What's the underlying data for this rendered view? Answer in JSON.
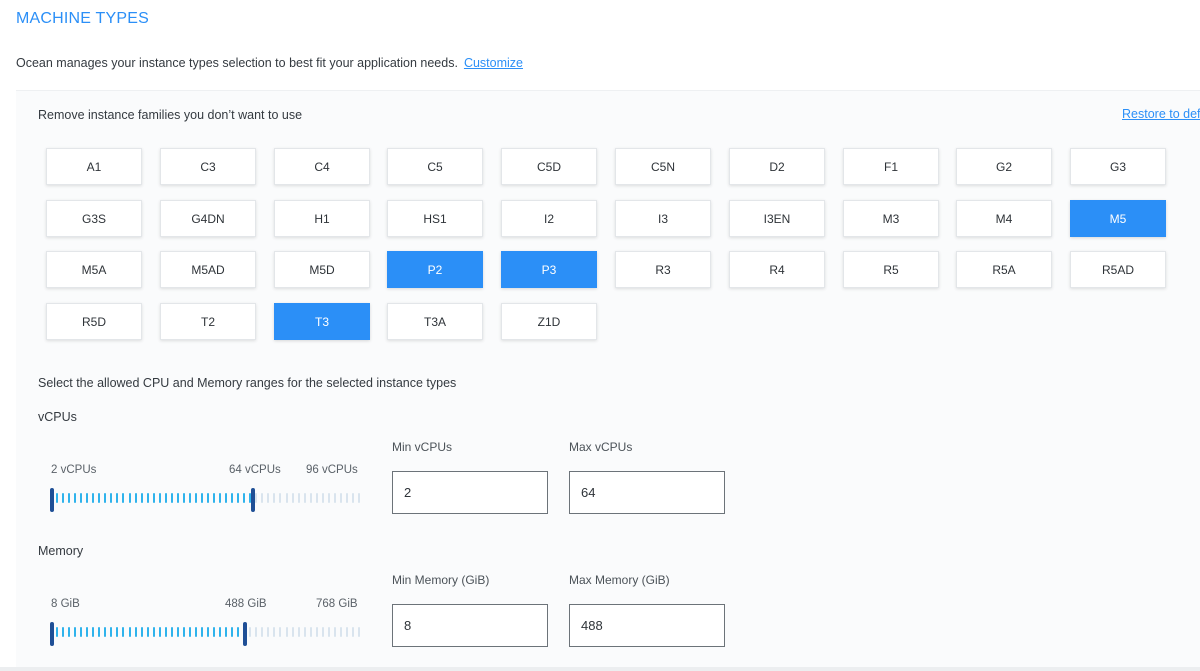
{
  "header": {
    "title": "MACHINE TYPES",
    "intro_text": "Ocean manages your instance types selection to best fit your application needs.",
    "customize_link": "Customize"
  },
  "families": {
    "label": "Remove instance families you don’t want to use",
    "restore_link": "Restore to defa",
    "items": [
      {
        "label": "A1",
        "selected": false
      },
      {
        "label": "C3",
        "selected": false
      },
      {
        "label": "C4",
        "selected": false
      },
      {
        "label": "C5",
        "selected": false
      },
      {
        "label": "C5D",
        "selected": false
      },
      {
        "label": "C5N",
        "selected": false
      },
      {
        "label": "D2",
        "selected": false
      },
      {
        "label": "F1",
        "selected": false
      },
      {
        "label": "G2",
        "selected": false
      },
      {
        "label": "G3",
        "selected": false
      },
      {
        "label": "G3S",
        "selected": false
      },
      {
        "label": "G4DN",
        "selected": false
      },
      {
        "label": "H1",
        "selected": false
      },
      {
        "label": "HS1",
        "selected": false
      },
      {
        "label": "I2",
        "selected": false
      },
      {
        "label": "I3",
        "selected": false
      },
      {
        "label": "I3EN",
        "selected": false
      },
      {
        "label": "M3",
        "selected": false
      },
      {
        "label": "M4",
        "selected": false
      },
      {
        "label": "M5",
        "selected": true
      },
      {
        "label": "M5A",
        "selected": false
      },
      {
        "label": "M5AD",
        "selected": false
      },
      {
        "label": "M5D",
        "selected": false
      },
      {
        "label": "P2",
        "selected": true
      },
      {
        "label": "P3",
        "selected": true
      },
      {
        "label": "R3",
        "selected": false
      },
      {
        "label": "R4",
        "selected": false
      },
      {
        "label": "R5",
        "selected": false
      },
      {
        "label": "R5A",
        "selected": false
      },
      {
        "label": "R5AD",
        "selected": false
      },
      {
        "label": "R5D",
        "selected": false
      },
      {
        "label": "T2",
        "selected": false
      },
      {
        "label": "T3",
        "selected": true
      },
      {
        "label": "T3A",
        "selected": false
      },
      {
        "label": "Z1D",
        "selected": false
      }
    ]
  },
  "ranges": {
    "label": "Select the allowed CPU and Memory ranges for the selected instance types",
    "vcpu": {
      "title": "vCPUs",
      "min_tick": "2 vCPUs",
      "handle_tick": "64 vCPUs",
      "max_tick": "96 vCPUs",
      "range_min": 2,
      "range_max": 96,
      "selected_min": 2,
      "selected_max": 64,
      "min_field_label": "Min vCPUs",
      "min_field_value": "2",
      "max_field_label": "Max vCPUs",
      "max_field_value": "64"
    },
    "memory": {
      "title": "Memory",
      "min_tick": "8 GiB",
      "handle_tick": "488 GiB",
      "max_tick": "768 GiB",
      "range_min": 8,
      "range_max": 768,
      "selected_min": 8,
      "selected_max": 488,
      "min_field_label": "Min Memory (GiB)",
      "min_field_value": "8",
      "max_field_label": "Max Memory (GiB)",
      "max_field_value": "488"
    }
  },
  "colors": {
    "accent": "#2b8ff7",
    "tick_active": "#2fb3ec",
    "tick_inactive": "#d9e4ee",
    "handle": "#1f4f96"
  }
}
